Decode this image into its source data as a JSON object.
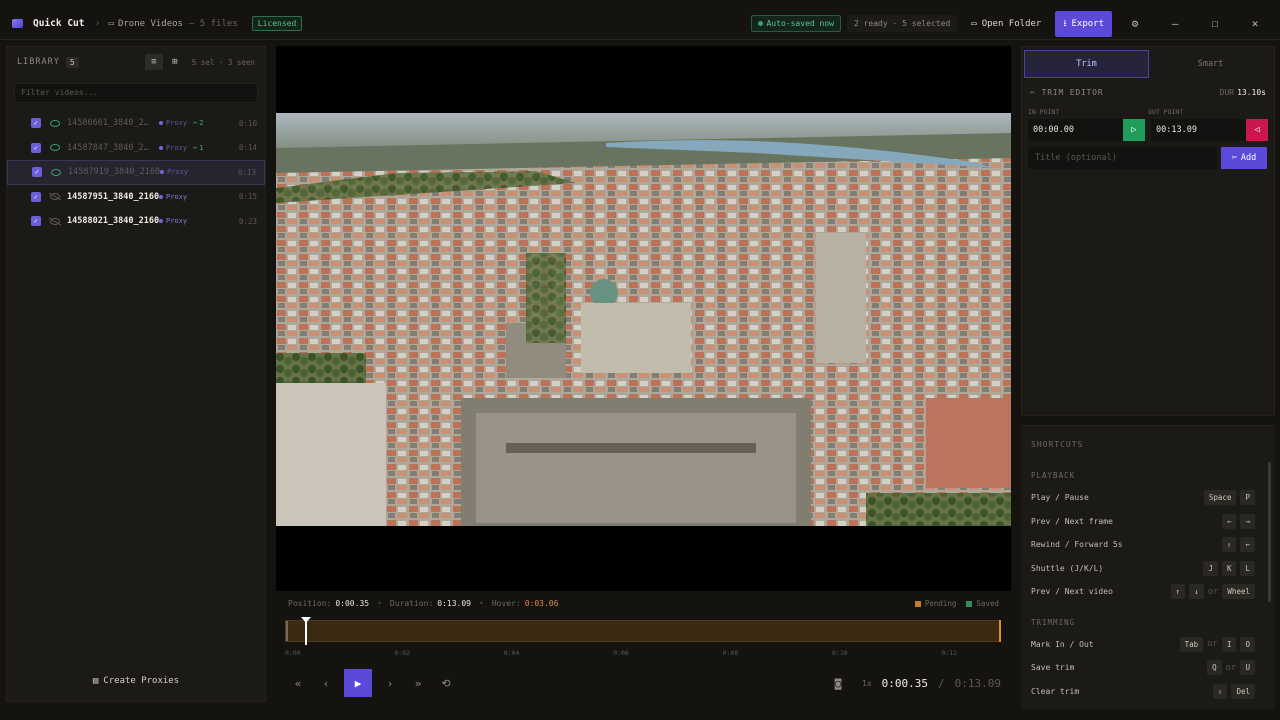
{
  "topbar": {
    "app_title": "Quick Cut",
    "separator": "›",
    "folder_name": "Drone Videos",
    "file_count": "— 5 files",
    "license_badge": "Licensed",
    "autosave": "Auto-saved now",
    "status_counts": "2 ready · 5 selected",
    "open_folder": "Open Folder",
    "export": "Export",
    "icons": {
      "minimize": "—",
      "maximize": "☐",
      "close": "✕",
      "settings": "⚙"
    }
  },
  "library": {
    "title": "LIBRARY",
    "count": "5",
    "stats": "5 sel · 3 seen",
    "filter_placeholder": "Filter videos...",
    "items": [
      {
        "name": "14586661_3840_2…",
        "proxy": "Proxy",
        "clips": "2",
        "duration": "0:10",
        "seen": true,
        "dim": true
      },
      {
        "name": "14587847_3840_2…",
        "proxy": "Proxy",
        "clips": "1",
        "duration": "0:14",
        "seen": true,
        "dim": true
      },
      {
        "name": "14587919_3840_2160_…",
        "proxy": "Proxy",
        "clips": "",
        "duration": "0:13",
        "seen": true,
        "dim": true
      },
      {
        "name": "14587951_3840_2160_…",
        "proxy": "Proxy",
        "clips": "",
        "duration": "0:15",
        "seen": false,
        "dim": false
      },
      {
        "name": "14588021_3840_2160_…",
        "proxy": "Proxy",
        "clips": "",
        "duration": "0:23",
        "seen": false,
        "dim": false
      }
    ],
    "create_proxies": "Create Proxies"
  },
  "player": {
    "position_label": "Position:",
    "position": "0:00.35",
    "duration_label": "Duration:",
    "duration": "0:13.09",
    "hover_label": "Hover:",
    "hover": "0:03.06",
    "legend_pending": "Pending",
    "legend_saved": "Saved",
    "ticks": [
      "0:00",
      "0:02",
      "0:04",
      "0:06",
      "0:08",
      "0:10",
      "0:12"
    ],
    "speed": "1x",
    "current_time": "0:00.35",
    "time_sep": "/",
    "total_time": "0:13.09",
    "playhead_fraction": 0.027
  },
  "right_panel": {
    "tabs": [
      "Trim",
      "Smart"
    ],
    "editor_title": "TRIM EDITOR",
    "dur_label": "DUR",
    "dur_value": "13.10s",
    "in_label": "IN POINT",
    "out_label": "OUT POINT",
    "in_value": "00:00.00",
    "out_value": "00:13.09",
    "title_placeholder": "Title (optional)",
    "add": "Add"
  },
  "shortcuts": {
    "title": "SHORTCUTS",
    "playback_title": "PLAYBACK",
    "playback": [
      {
        "label": "Play / Pause",
        "keys": [
          "Space",
          "P"
        ]
      },
      {
        "label": "Prev / Next frame",
        "keys": [
          "←",
          "→"
        ]
      },
      {
        "label": "Rewind / Forward 5s",
        "keys": [
          "⇧",
          "←"
        ]
      },
      {
        "label": "Shuttle (J/K/L)",
        "keys": [
          "J",
          "K",
          "L"
        ]
      },
      {
        "label": "Prev / Next video",
        "keys": [
          "↑",
          "↓",
          "or",
          "Wheel"
        ]
      }
    ],
    "trimming_title": "TRIMMING",
    "trimming": [
      {
        "label": "Mark In / Out",
        "keys": [
          "Tab",
          "or",
          "I",
          "O"
        ]
      },
      {
        "label": "Save trim",
        "keys": [
          "Q",
          "or",
          "U"
        ]
      },
      {
        "label": "Clear trim",
        "keys": [
          "⇧",
          "Del"
        ]
      }
    ]
  },
  "colors": {
    "accent": "#5b4ad8",
    "saved": "#3aa06e",
    "pending": "#e08a2e",
    "out_point": "#c8184f",
    "in_point": "#1e9e5a"
  }
}
